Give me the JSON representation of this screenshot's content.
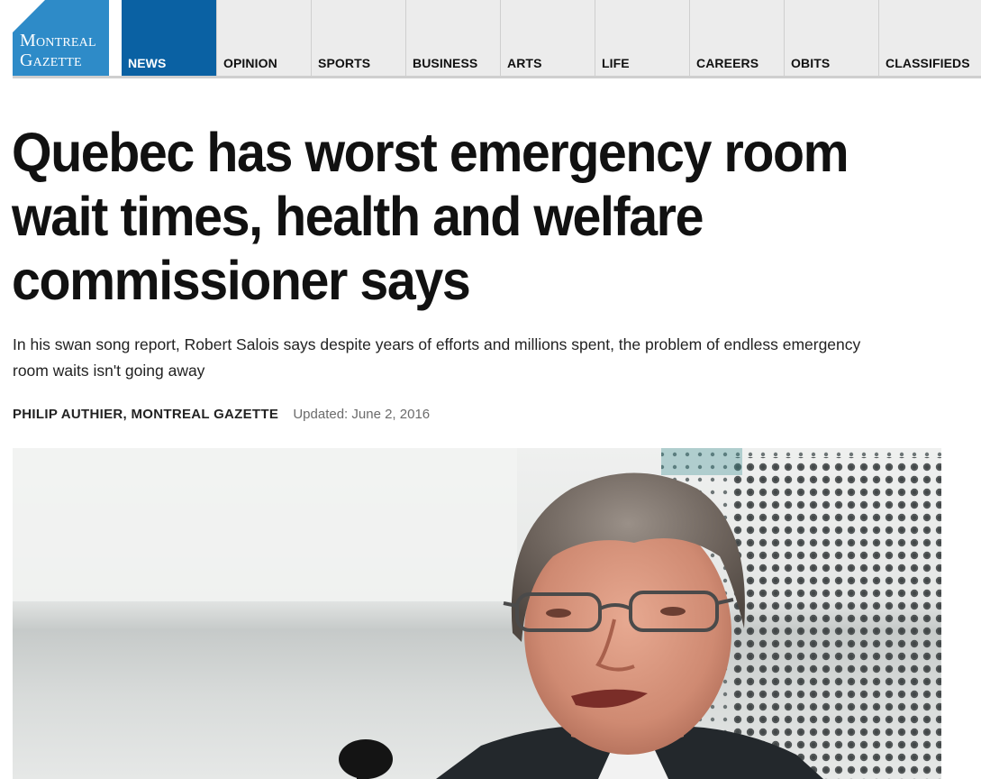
{
  "brand": {
    "line1": "Montreal",
    "line2": "Gazette",
    "color": "#2e8bc8"
  },
  "nav": {
    "items": [
      {
        "label": "NEWS",
        "active": true
      },
      {
        "label": "OPINION"
      },
      {
        "label": "SPORTS"
      },
      {
        "label": "BUSINESS"
      },
      {
        "label": "ARTS"
      },
      {
        "label": "LIFE"
      },
      {
        "label": "CAREERS"
      },
      {
        "label": "OBITS"
      },
      {
        "label": "CLASSIFIEDS"
      }
    ],
    "active_color": "#0a61a3"
  },
  "article": {
    "headline": "Quebec has worst emergency room wait times, health and welfare commissioner says",
    "dek": "In his swan song report, Robert Salois says despite years of efforts and millions spent, the problem of endless emergency room waits isn't going away",
    "author": "PHILIP AUTHIER, MONTREAL GAZETTE",
    "updated": "Updated: June 2, 2016"
  }
}
